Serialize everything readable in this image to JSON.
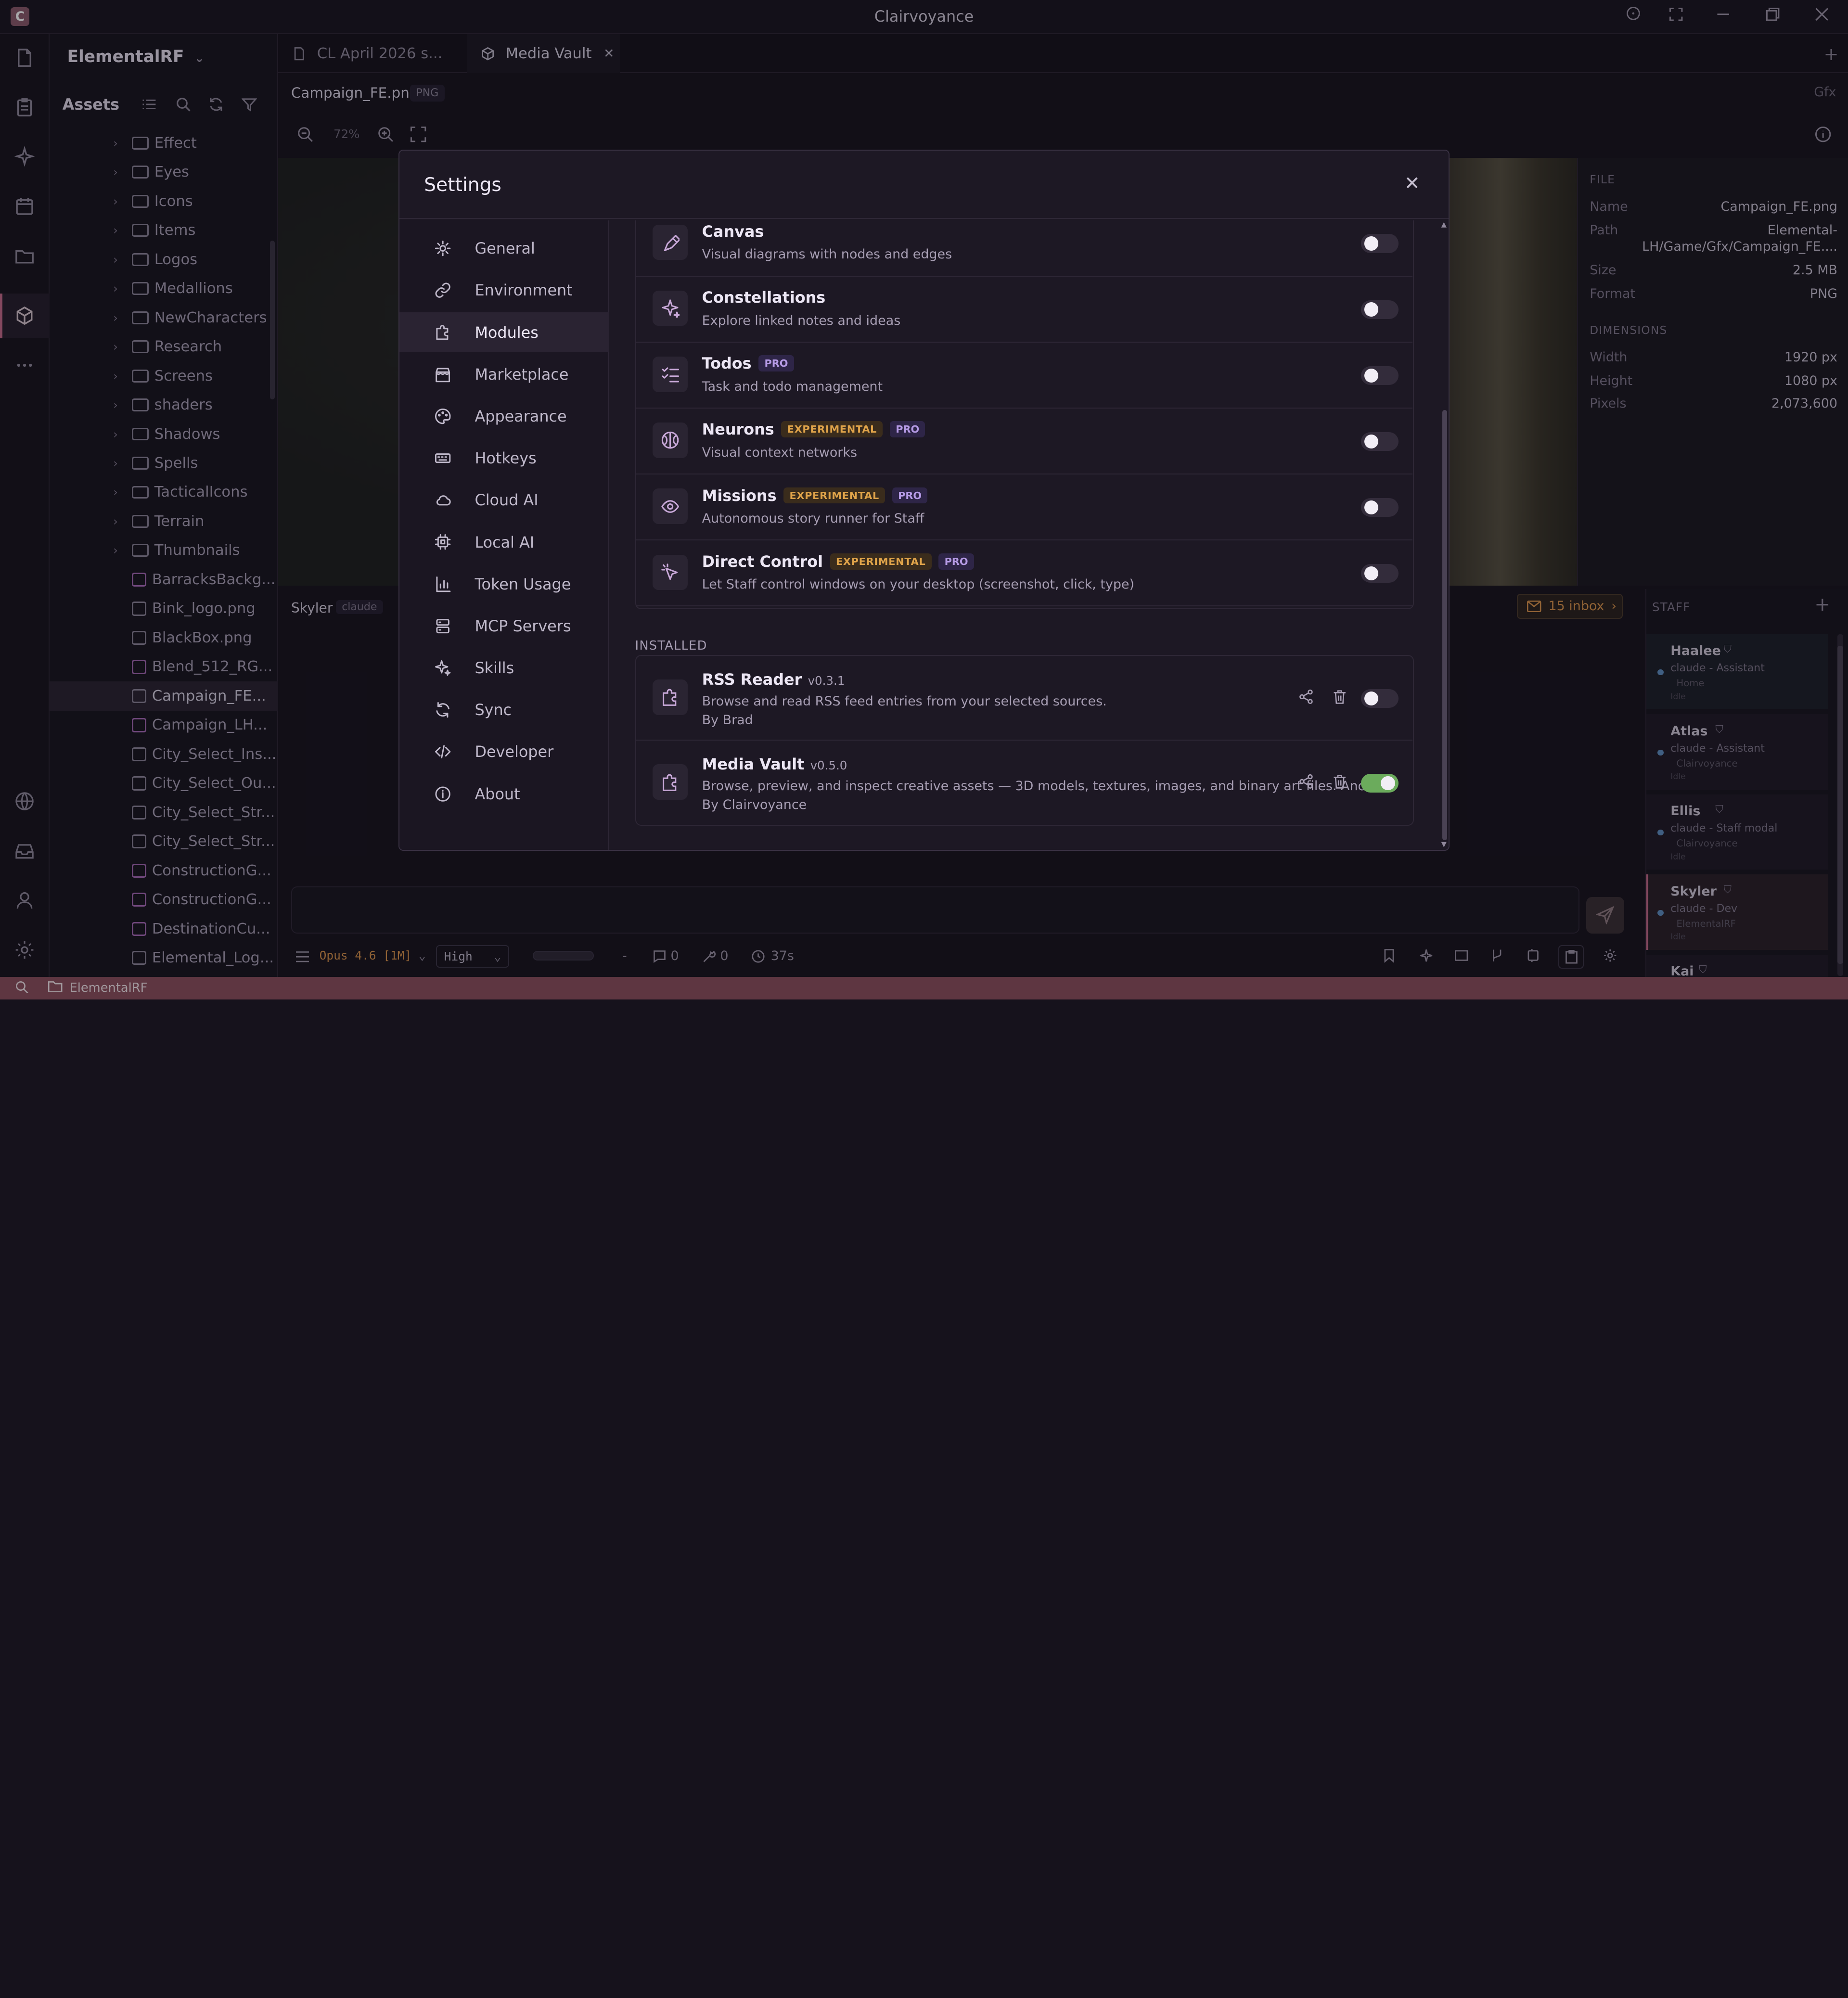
{
  "window": {
    "title": "Clairvoyance",
    "logo_letter": "C"
  },
  "workspace": {
    "name": "ElementalRF"
  },
  "assets": {
    "title": "Assets",
    "folders": [
      "Effect",
      "Eyes",
      "Icons",
      "Items",
      "Logos",
      "Medallions",
      "NewCharacters",
      "Research",
      "Screens",
      "shaders",
      "Shadows",
      "Spells",
      "TacticalIcons",
      "Terrain",
      "Thumbnails"
    ],
    "files": [
      "BarracksBackg...",
      "Bink_logo.png",
      "BlackBox.png",
      "Blend_512_RG...",
      "Campaign_FE...",
      "Campaign_LH...",
      "City_Select_Ins...",
      "City_Select_Ou...",
      "City_Select_Str...",
      "City_Select_Str...",
      "ConstructionG...",
      "ConstructionG...",
      "DestinationCu...",
      "Elemental_Log..."
    ],
    "selected_file": "Campaign_FE..."
  },
  "tabs": [
    {
      "label": "CL April 2026 s...",
      "active": false
    },
    {
      "label": "Media Vault",
      "active": true
    }
  ],
  "file": {
    "name": "Campaign_FE.png",
    "type_badge": "PNG",
    "section": "Gfx",
    "zoom": "72%"
  },
  "info": {
    "file_header": "FILE",
    "name_label": "Name",
    "name_value": "Campaign_FE.png",
    "path_label": "Path",
    "path_value_1": "Elemental-",
    "path_value_2": "LH/Game/Gfx/Campaign_FE....",
    "size_label": "Size",
    "size_value": "2.5 MB",
    "format_label": "Format",
    "format_value": "PNG",
    "dim_header": "DIMENSIONS",
    "width_label": "Width",
    "width_value": "1920 px",
    "height_label": "Height",
    "height_value": "1080 px",
    "pixels_label": "Pixels",
    "pixels_value": "2,073,600"
  },
  "chat": {
    "agent": "Skyler",
    "agent_tag": "claude",
    "inbox": "15 inbox"
  },
  "bottom": {
    "model": "Opus 4.6 [1M]",
    "effort": "High",
    "dash": "-",
    "comments": "0",
    "tools": "0",
    "time": "37s"
  },
  "staff": {
    "header": "STAFF",
    "members": [
      {
        "name": "Haalee",
        "role": "claude - Assistant",
        "dir": "Home",
        "state": "Idle"
      },
      {
        "name": "Atlas",
        "role": "claude - Assistant",
        "dir": "Clairvoyance",
        "state": "Idle"
      },
      {
        "name": "Ellis",
        "role": "claude - Staff modal",
        "dir": "Clairvoyance",
        "state": "Idle"
      },
      {
        "name": "Skyler",
        "role": "claude - Dev",
        "dir": "ElementalRF",
        "state": "Idle"
      },
      {
        "name": "Kai",
        "role": "",
        "dir": "",
        "state": ""
      }
    ]
  },
  "statusbar": {
    "path": "ElementalRF"
  },
  "settings": {
    "title": "Settings",
    "nav": [
      {
        "label": "General",
        "icon": "gear-icon"
      },
      {
        "label": "Environment",
        "icon": "link-icon"
      },
      {
        "label": "Modules",
        "icon": "puzzle-icon",
        "active": true
      },
      {
        "label": "Marketplace",
        "icon": "store-icon"
      },
      {
        "label": "Appearance",
        "icon": "palette-icon"
      },
      {
        "label": "Hotkeys",
        "icon": "keyboard-icon"
      },
      {
        "label": "Cloud AI",
        "icon": "cloud-icon"
      },
      {
        "label": "Local AI",
        "icon": "chip-icon"
      },
      {
        "label": "Token Usage",
        "icon": "bar-chart-icon"
      },
      {
        "label": "MCP Servers",
        "icon": "server-icon"
      },
      {
        "label": "Skills",
        "icon": "sparkle-icon"
      },
      {
        "label": "Sync",
        "icon": "sync-icon"
      },
      {
        "label": "Developer",
        "icon": "code-icon"
      },
      {
        "label": "About",
        "icon": "info-icon"
      }
    ],
    "modules": [
      {
        "name": "Canvas",
        "desc": "Visual diagrams with nodes and edges",
        "experimental": false,
        "pro": false,
        "enabled": false
      },
      {
        "name": "Constellations",
        "desc": "Explore linked notes and ideas",
        "experimental": false,
        "pro": false,
        "enabled": false
      },
      {
        "name": "Todos",
        "desc": "Task and todo management",
        "experimental": false,
        "pro": true,
        "enabled": false
      },
      {
        "name": "Neurons",
        "desc": "Visual context networks",
        "experimental": true,
        "pro": true,
        "enabled": false
      },
      {
        "name": "Missions",
        "desc": "Autonomous story runner for Staff",
        "experimental": true,
        "pro": true,
        "enabled": false
      },
      {
        "name": "Direct Control",
        "desc": "Let Staff control windows on your desktop (screenshot, click, type)",
        "experimental": true,
        "pro": true,
        "enabled": false
      }
    ],
    "tag_experimental": "EXPERIMENTAL",
    "tag_pro": "PRO",
    "installed_header": "INSTALLED",
    "installed": [
      {
        "name": "RSS Reader",
        "version": "v0.3.1",
        "desc": "Browse and read RSS feed entries from your selected sources.",
        "by": "By Brad",
        "enabled": false
      },
      {
        "name": "Media Vault",
        "version": "v0.5.0",
        "desc": "Browse, preview, and inspect creative assets — 3D models, textures, images, and binary art files. Anch...",
        "by": "By Clairvoyance",
        "enabled": true
      }
    ]
  },
  "colors": {
    "accent": "#c66a8a",
    "toggle_on": "#6bab5c",
    "statusbar": "#8c4f5c",
    "experimental": "#e0a44a",
    "pro": "#b69be6"
  }
}
